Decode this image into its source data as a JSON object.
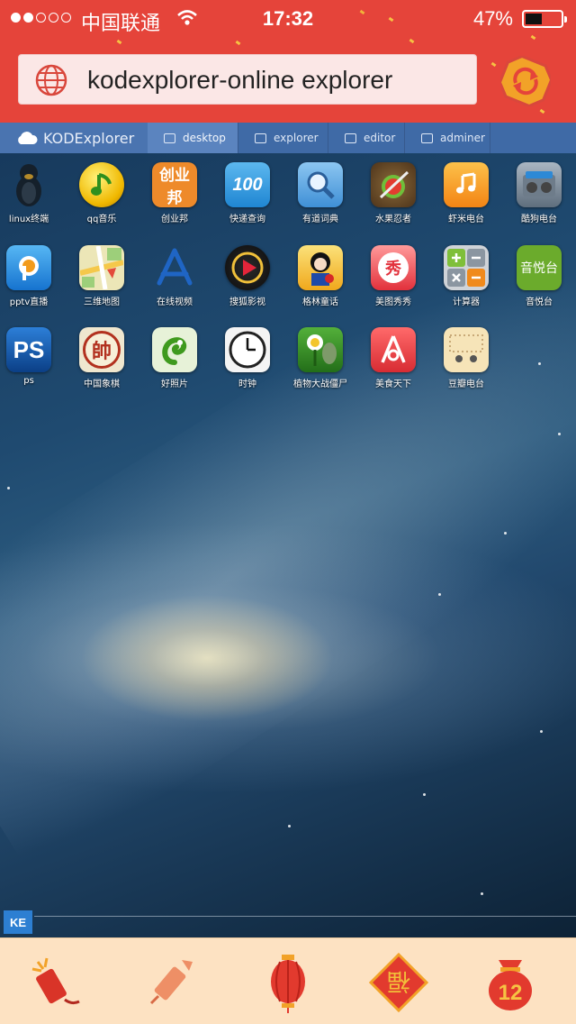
{
  "status_bar": {
    "signal_bars": 2,
    "signal_total": 5,
    "carrier": "中国联通",
    "time": "17:32",
    "battery_percent_text": "47%",
    "battery_level": 0.47
  },
  "browser": {
    "url": "kodexplorer-online explorer",
    "reload_icon": "reload-icon",
    "globe_icon": "globe-icon"
  },
  "kod_nav": {
    "brand": "KODExplorer",
    "tabs": [
      {
        "label": "desktop",
        "icon": "monitor-icon",
        "active": true
      },
      {
        "label": "explorer",
        "icon": "folder-list-icon",
        "active": false
      },
      {
        "label": "editor",
        "icon": "edit-icon",
        "active": false
      },
      {
        "label": "adminer",
        "icon": "database-icon",
        "active": false
      }
    ]
  },
  "desktop": {
    "apps": [
      {
        "label": "linux终端",
        "icon": "tux-icon",
        "color": "#1b2a3c"
      },
      {
        "label": "qq音乐",
        "icon": "qq-music-icon",
        "color": "#f4c300"
      },
      {
        "label": "创业邦",
        "icon": "chuangyebang-icon",
        "color": "#ee8a2a",
        "glyph": "创业邦"
      },
      {
        "label": "快递查询",
        "icon": "kuaidi-icon",
        "color": "#2f9be0",
        "glyph": "100"
      },
      {
        "label": "有道词典",
        "icon": "youdao-icon",
        "color": "#5fa6e3"
      },
      {
        "label": "水果忍者",
        "icon": "fruit-ninja-icon",
        "color": "#6d4b25"
      },
      {
        "label": "虾米电台",
        "icon": "xiami-icon",
        "color": "#f79a1f"
      },
      {
        "label": "酷狗电台",
        "icon": "kugou-radio-icon",
        "color": "#7e8c9b"
      },
      {
        "label": "pptv直播",
        "icon": "pptv-icon",
        "color": "#1e8be5"
      },
      {
        "label": "三维地图",
        "icon": "map-icon",
        "color": "#e9e2b4"
      },
      {
        "label": "在线视频",
        "icon": "app-store-icon",
        "color": "#1f5fb0"
      },
      {
        "label": "搜狐影视",
        "icon": "sohu-video-icon",
        "color": "#c91f26"
      },
      {
        "label": "格林童话",
        "icon": "snow-white-icon",
        "color": "#f3c52c"
      },
      {
        "label": "美图秀秀",
        "icon": "meitu-icon",
        "color": "#e8444d",
        "glyph": "秀"
      },
      {
        "label": "计算器",
        "icon": "calculator-icon",
        "color": "#c3c7cc"
      },
      {
        "label": "音悦台",
        "icon": "yinyuetai-icon",
        "color": "#6bab2c",
        "glyph": "音悦台"
      },
      {
        "label": "ps",
        "icon": "photoshop-icon",
        "color": "#1a5ca8",
        "glyph": "PS"
      },
      {
        "label": "中国象棋",
        "icon": "chess-icon",
        "color": "#f2ecd9",
        "glyph": "帥"
      },
      {
        "label": "好照片",
        "icon": "chameleon-icon",
        "color": "#cfe7b9"
      },
      {
        "label": "时钟",
        "icon": "clock-icon",
        "color": "#f3f3f3"
      },
      {
        "label": "植物大战僵尸",
        "icon": "plants-vs-zombies-icon",
        "color": "#3a8f2a"
      },
      {
        "label": "美食天下",
        "icon": "meishi-icon",
        "color": "#e64545"
      },
      {
        "label": "豆瓣电台",
        "icon": "douban-radio-icon",
        "color": "#f5e3b8"
      }
    ],
    "corner_logo": "KE"
  },
  "bottom_bar": {
    "buttons": [
      {
        "icon": "firecracker-icon"
      },
      {
        "icon": "firework-rocket-icon"
      },
      {
        "icon": "lantern-icon"
      },
      {
        "icon": "fu-diamond-icon",
        "text": "福"
      },
      {
        "icon": "lucky-bag-icon",
        "text": "12"
      }
    ]
  },
  "colors": {
    "chrome_red": "#e5443a",
    "kod_bar_blue": "#3f6aa6",
    "bottom_bar_peach": "#fde2c2"
  }
}
